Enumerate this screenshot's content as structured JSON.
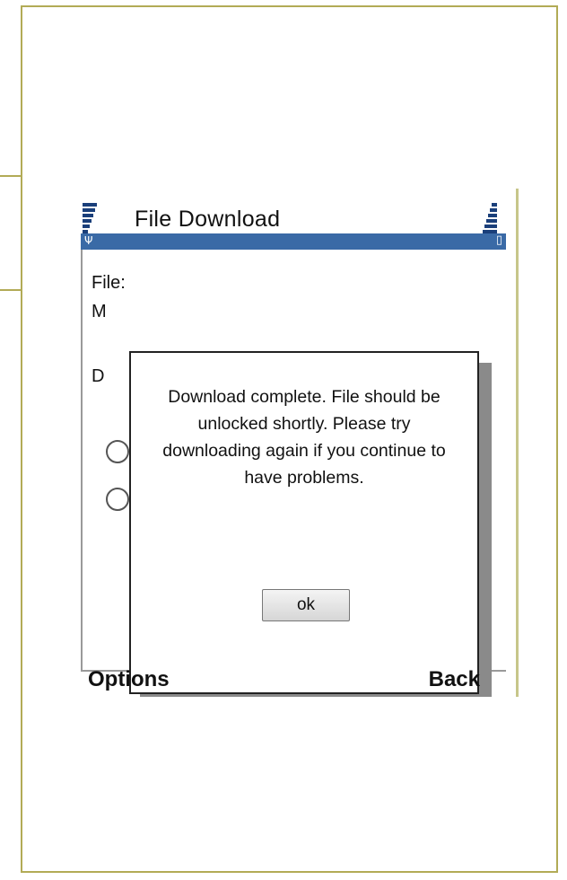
{
  "window": {
    "title": "File Download"
  },
  "background_form": {
    "labels": [
      "File:",
      "M",
      "D"
    ]
  },
  "dialog": {
    "message": "Download complete. File should be unlocked shortly. Please try downloading again if you continue to have problems.",
    "ok_label": "ok"
  },
  "softkeys": {
    "left_label": "Options",
    "right_label": "Back"
  },
  "status": {
    "signal_icon": "signal-strength-icon",
    "battery_icon": "battery-icon"
  },
  "colors": {
    "frame": "#b2ab56",
    "title_bar_blue": "#3a6aa6",
    "bar_dark_blue": "#1a3f7a"
  }
}
